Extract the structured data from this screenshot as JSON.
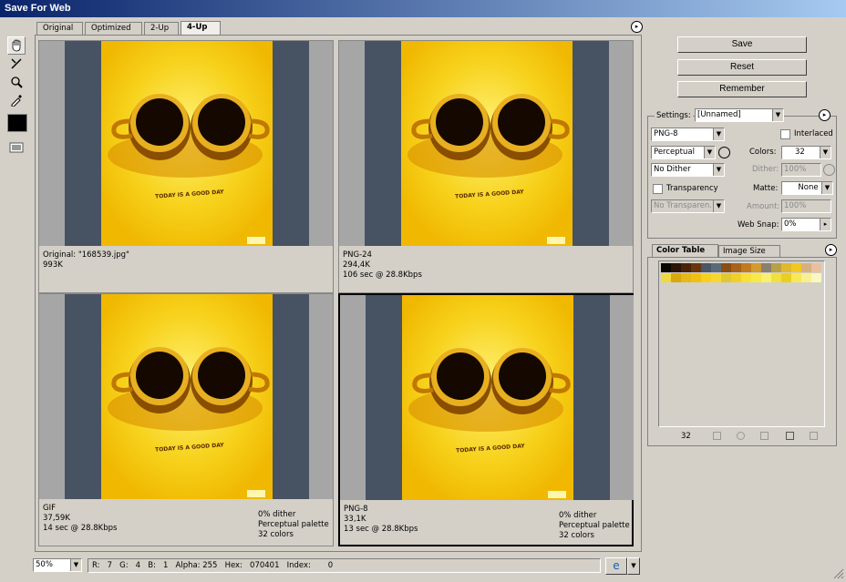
{
  "window": {
    "title": "Save For Web"
  },
  "tabs": [
    "Original",
    "Optimized",
    "2-Up",
    "4-Up"
  ],
  "panes": [
    {
      "line1": "Original: \"168539.jpg\"",
      "line2": "993K",
      "line3": "",
      "r1": "",
      "r2": "",
      "r3": ""
    },
    {
      "line1": "PNG-24",
      "line2": "294,4K",
      "line3": "106 sec @ 28.8Kbps",
      "r1": "",
      "r2": "",
      "r3": ""
    },
    {
      "line1": "GIF",
      "line2": "37,59K",
      "line3": "14 sec @ 28.8Kbps",
      "r1": "0% dither",
      "r2": "Perceptual palette",
      "r3": "32 colors"
    },
    {
      "line1": "PNG-8",
      "line2": "33,1K",
      "line3": "13 sec @ 28.8Kbps",
      "r1": "0% dither",
      "r2": "Perceptual palette",
      "r3": "32 colors"
    }
  ],
  "artwork": {
    "slogan": "TODAY IS A GOOD DAY"
  },
  "buttons": {
    "save": "Save",
    "reset": "Reset",
    "remember": "Remember"
  },
  "settings": {
    "label": "Settings:",
    "preset": "[Unnamed]",
    "format": "PNG-8",
    "interlaced": "Interlaced",
    "reduction": "Perceptual",
    "colors_label": "Colors:",
    "colors": "32",
    "dither_algo": "No Dither",
    "dither_label": "Dither:",
    "dither": "100%",
    "transparency": "Transparency",
    "matte_label": "Matte:",
    "matte": "None",
    "trans_dither": "No Transparen...",
    "amount_label": "Amount:",
    "amount": "100%",
    "websnap_label": "Web Snap:",
    "websnap": "0%"
  },
  "color_table": {
    "tab1": "Color Table",
    "tab2": "Image Size",
    "count": "32",
    "swatches": [
      "#0b0602",
      "#2c1406",
      "#4a2208",
      "#6a340c",
      "#4a5566",
      "#5b6a78",
      "#8a4e12",
      "#a8621a",
      "#c27a20",
      "#d49a2e",
      "#8a8070",
      "#b8a048",
      "#e0b830",
      "#f0c820",
      "#d8b080",
      "#e8c0a0",
      "#f0d840",
      "#d8a810",
      "#e8b818",
      "#f0c010",
      "#f8d020",
      "#f8d830",
      "#e0c830",
      "#f0d028",
      "#f8e038",
      "#f8e848",
      "#f8f070",
      "#f0e040",
      "#e8d020",
      "#f8e858",
      "#f8f090",
      "#f8f8c0"
    ]
  },
  "status": {
    "zoom": "50%",
    "readout": "R:   7   G:   4   B:   1   Alpha: 255   Hex:   070401   Index:       0"
  },
  "colors": {
    "title": "#0a246a",
    "bg": "#d4d0c8",
    "yellow": "#f7d21c",
    "slate": "#475363"
  }
}
